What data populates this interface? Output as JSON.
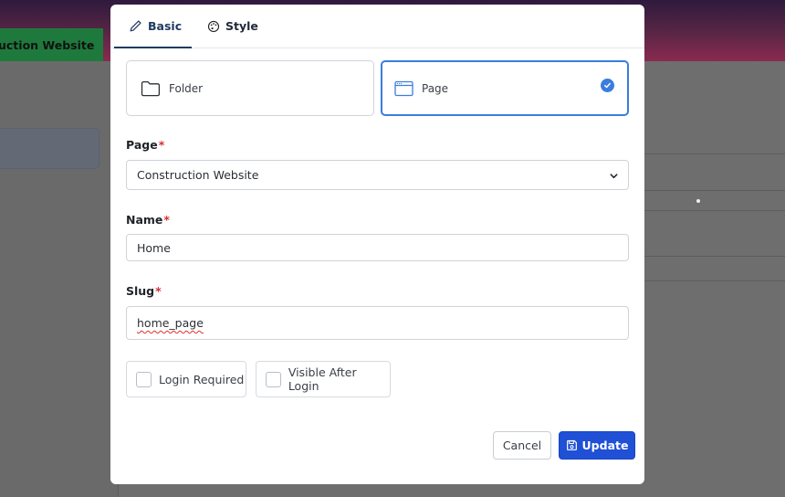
{
  "background": {
    "project_selector": "uction Website"
  },
  "tabs": [
    {
      "label": "Basic",
      "icon": "pencil-icon",
      "active": true
    },
    {
      "label": "Style",
      "icon": "palette-icon",
      "active": false
    }
  ],
  "type_options": [
    {
      "label": "Folder",
      "icon": "folder-icon",
      "selected": false
    },
    {
      "label": "Page",
      "icon": "browser-window-icon",
      "selected": true
    }
  ],
  "fields": {
    "page": {
      "label": "Page",
      "required_mark": "*",
      "value": "Construction Website"
    },
    "name": {
      "label": "Name",
      "required_mark": "*",
      "value": "Home"
    },
    "slug": {
      "label": "Slug",
      "required_mark": "*",
      "value": "home_page"
    }
  },
  "checkboxes": {
    "login_required": {
      "label": "Login Required",
      "checked": false
    },
    "visible_after_login": {
      "label": "Visible After Login",
      "checked": false
    }
  },
  "buttons": {
    "cancel": "Cancel",
    "update": "Update"
  },
  "colors": {
    "accent": "#3b7ddd",
    "primary_button": "#1f50d6",
    "required": "#d63030",
    "active_tab": "#1f3a5f"
  }
}
